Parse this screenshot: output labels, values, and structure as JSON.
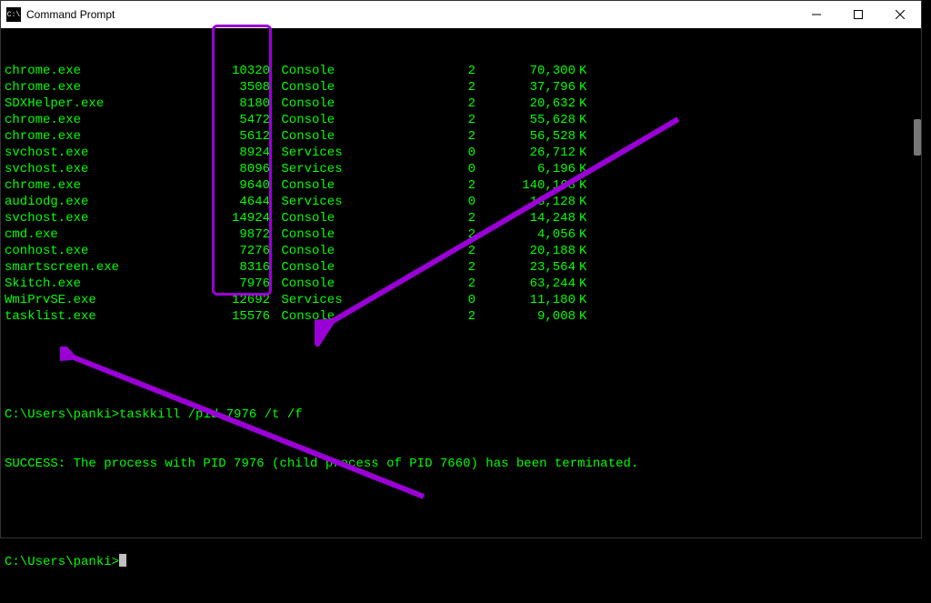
{
  "window": {
    "title": "Command Prompt"
  },
  "processes": [
    {
      "name": "chrome.exe",
      "pid": "10320",
      "session": "Console",
      "snum": "2",
      "mem": "70,300"
    },
    {
      "name": "chrome.exe",
      "pid": "3508",
      "session": "Console",
      "snum": "2",
      "mem": "37,796"
    },
    {
      "name": "SDXHelper.exe",
      "pid": "8180",
      "session": "Console",
      "snum": "2",
      "mem": "20,632"
    },
    {
      "name": "chrome.exe",
      "pid": "5472",
      "session": "Console",
      "snum": "2",
      "mem": "55,628"
    },
    {
      "name": "chrome.exe",
      "pid": "5612",
      "session": "Console",
      "snum": "2",
      "mem": "56,528"
    },
    {
      "name": "svchost.exe",
      "pid": "8924",
      "session": "Services",
      "snum": "0",
      "mem": "26,712"
    },
    {
      "name": "svchost.exe",
      "pid": "8096",
      "session": "Services",
      "snum": "0",
      "mem": "6,196"
    },
    {
      "name": "chrome.exe",
      "pid": "9640",
      "session": "Console",
      "snum": "2",
      "mem": "140,168"
    },
    {
      "name": "audiodg.exe",
      "pid": "4644",
      "session": "Services",
      "snum": "0",
      "mem": "13,128"
    },
    {
      "name": "svchost.exe",
      "pid": "14924",
      "session": "Console",
      "snum": "2",
      "mem": "14,248"
    },
    {
      "name": "cmd.exe",
      "pid": "9872",
      "session": "Console",
      "snum": "2",
      "mem": "4,056"
    },
    {
      "name": "conhost.exe",
      "pid": "7276",
      "session": "Console",
      "snum": "2",
      "mem": "20,188"
    },
    {
      "name": "smartscreen.exe",
      "pid": "8316",
      "session": "Console",
      "snum": "2",
      "mem": "23,564"
    },
    {
      "name": "Skitch.exe",
      "pid": "7976",
      "session": "Console",
      "snum": "2",
      "mem": "63,244"
    },
    {
      "name": "WmiPrvSE.exe",
      "pid": "12692",
      "session": "Services",
      "snum": "0",
      "mem": "11,180"
    },
    {
      "name": "tasklist.exe",
      "pid": "15576",
      "session": "Console",
      "snum": "2",
      "mem": "9,008"
    }
  ],
  "mem_unit": "K",
  "prompt1": {
    "path": "C:\\Users\\panki>",
    "command": "taskkill /pid 7976 /t /f"
  },
  "result": "SUCCESS: The process with PID 7976 (child process of PID 7660) has been terminated.",
  "prompt2": {
    "path": "C:\\Users\\panki>"
  },
  "annotation_color": "#9a00d6"
}
